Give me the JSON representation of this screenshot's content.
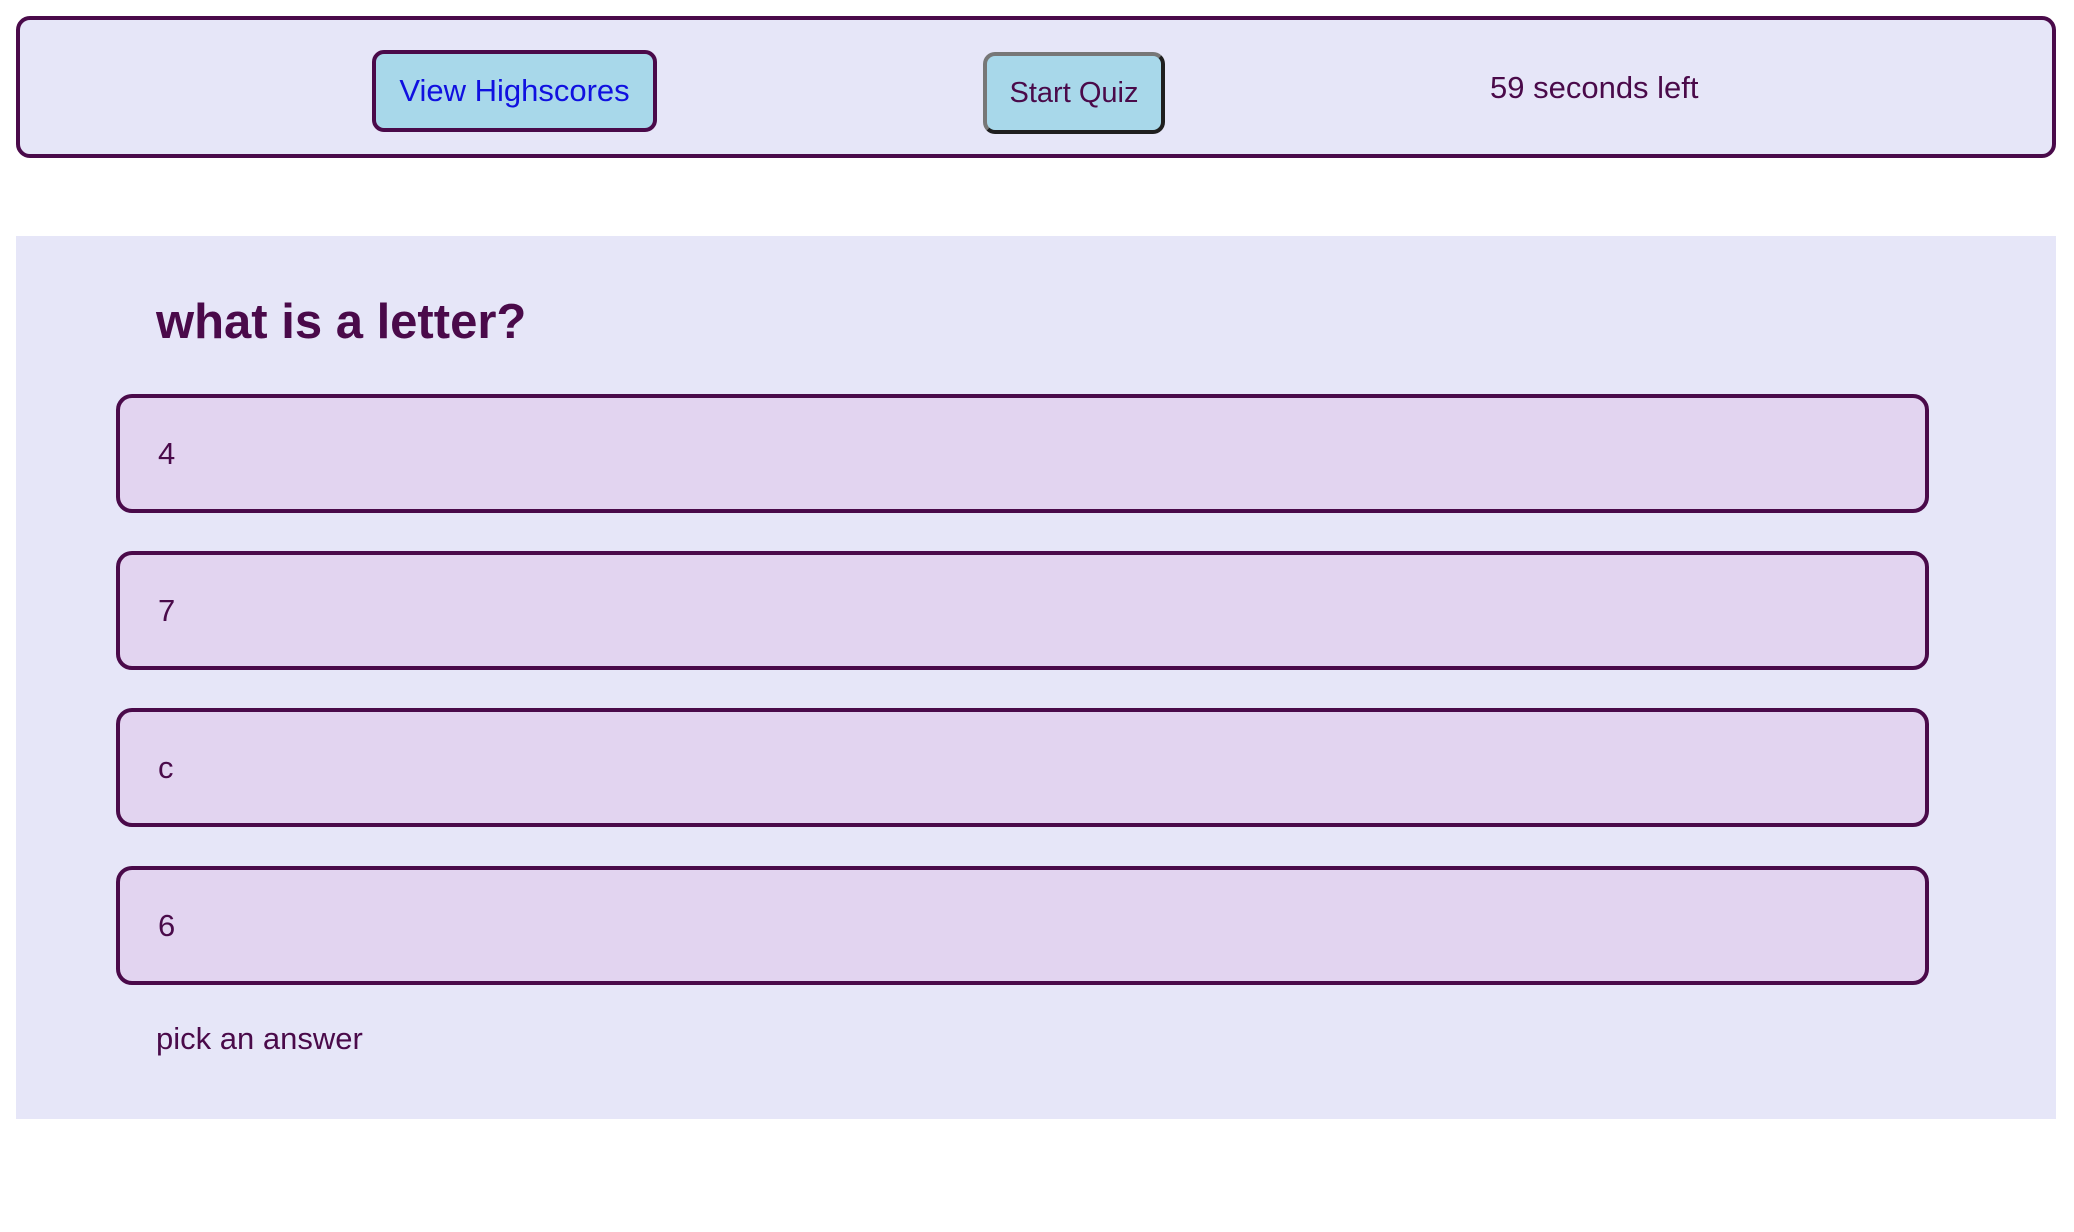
{
  "header": {
    "highscores_label": "View Highscores",
    "start_label": "Start Quiz",
    "timer_text": "59 seconds left"
  },
  "quiz": {
    "question": "what is a letter?",
    "answers": [
      "4",
      "7",
      "c",
      "6"
    ],
    "status": "pick an answer"
  },
  "colors": {
    "primary_text": "#4a0a4a",
    "panel_background": "#e6e6f8",
    "answer_background": "#e2d4f0",
    "button_background": "#a8d8ea",
    "link_blue": "#1010e0"
  }
}
